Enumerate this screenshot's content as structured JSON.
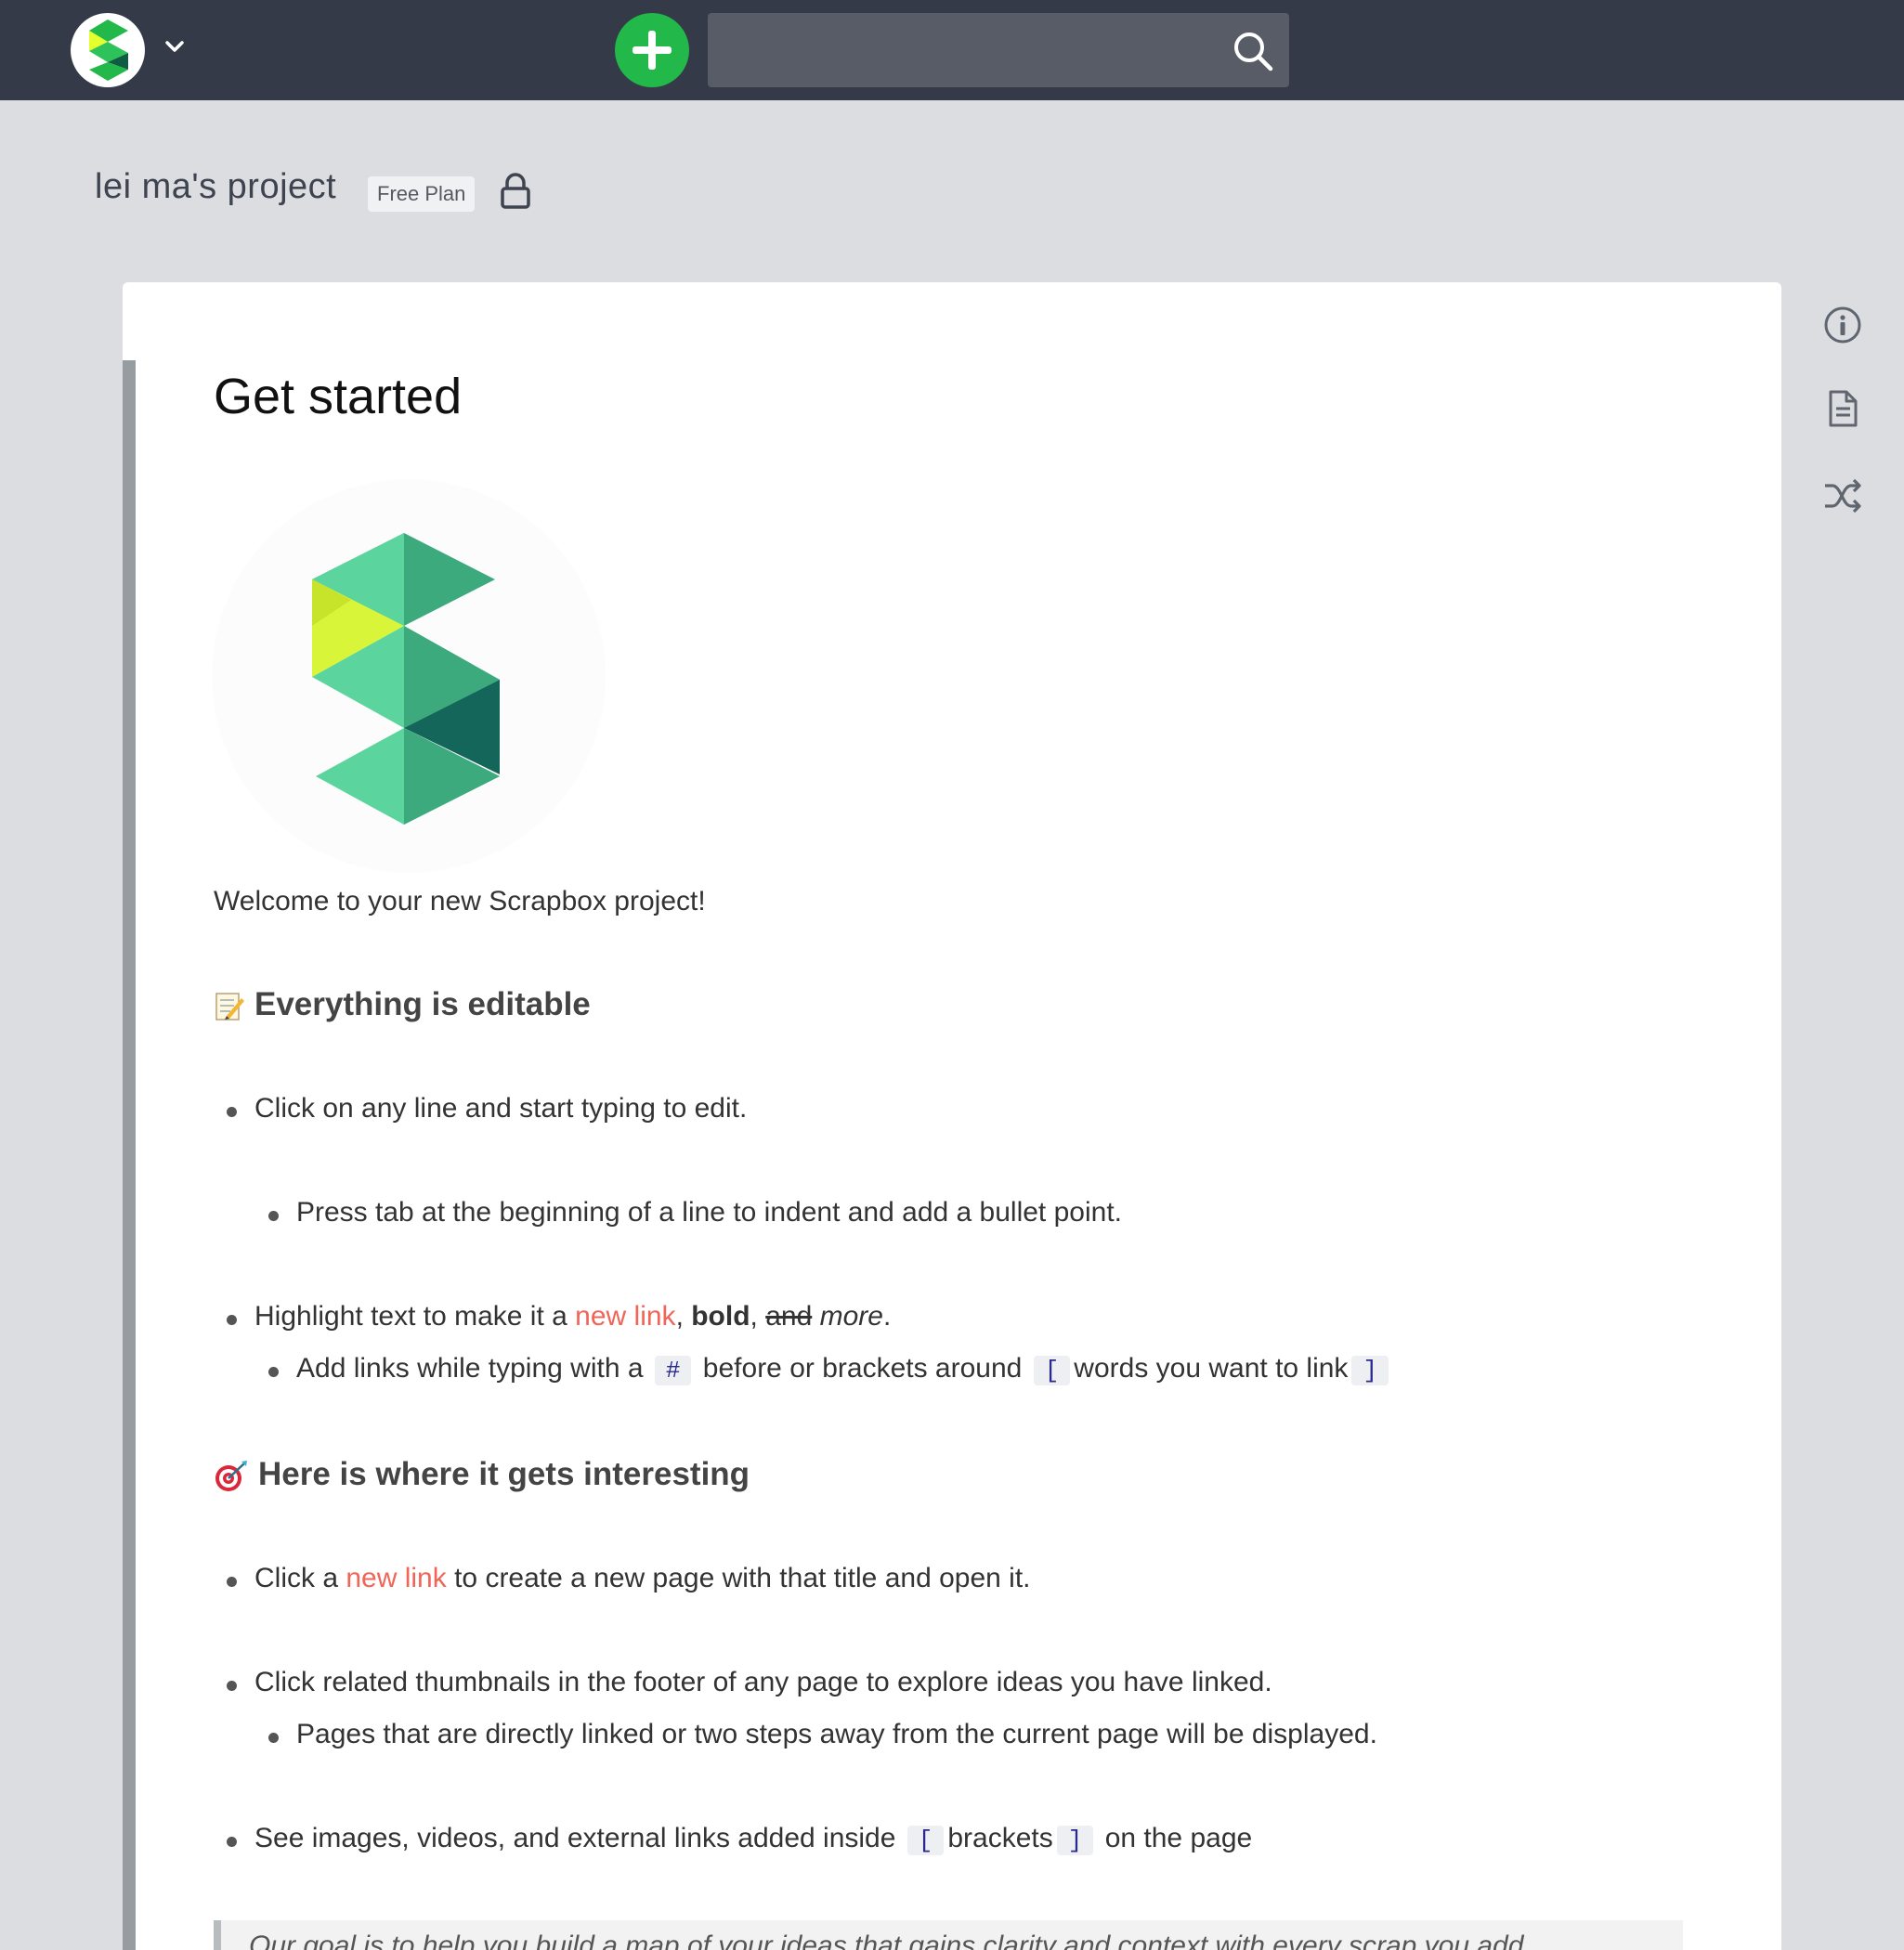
{
  "navbar": {
    "search_placeholder": ""
  },
  "project": {
    "name": "lei ma's project",
    "plan_badge": "Free Plan"
  },
  "page": {
    "title": "Get started",
    "welcome": "Welcome to your new Scrapbox project!",
    "section1": {
      "heading": "Everything is editable",
      "items": {
        "click_line": "Click on any line and start typing to edit.",
        "press_tab": "Press tab at the beginning of a line to indent and add a bullet point.",
        "highlight_prefix": "Highlight text to make it a ",
        "highlight_link": "new link",
        "highlight_comma": ", ",
        "highlight_bold": "bold",
        "highlight_comma2": ", ",
        "highlight_strike": "and",
        "highlight_space": " ",
        "highlight_italic": "more",
        "highlight_end": ".",
        "add_links_prefix": "Add links while typing with a ",
        "add_links_hash": "#",
        "add_links_middle": " before or brackets around ",
        "add_links_open": "[",
        "add_links_words": "words you want to link",
        "add_links_close": "]"
      }
    },
    "section2": {
      "heading": "Here is where it gets interesting",
      "items": {
        "click_a": "Click a ",
        "click_link": "new link",
        "click_rest": " to create a new page with that title and open it.",
        "thumbnails": "Click related thumbnails in the footer of any page to explore ideas you have linked.",
        "pages_linked": "Pages that are directly linked or two steps away from the current page will be displayed.",
        "see_prefix": "See images, videos, and external links added inside ",
        "see_open": "[",
        "see_brackets": "brackets",
        "see_close": "]",
        "see_suffix": " on the page"
      }
    },
    "quote": "Our goal is to help you build a map of your ideas that gains clarity and context with every scrap you add."
  },
  "colors": {
    "navbar": "#343a48",
    "new_button": "#22b84a",
    "new_link": "#f06557",
    "code_text": "#2a2a8e"
  },
  "icons": {
    "brand": "scrapbox-logo-icon",
    "caret": "chevron-down-icon",
    "new": "plus-icon",
    "search": "search-icon",
    "lock": "lock-icon",
    "info": "info-icon",
    "document": "document-icon",
    "random": "shuffle-icon"
  }
}
